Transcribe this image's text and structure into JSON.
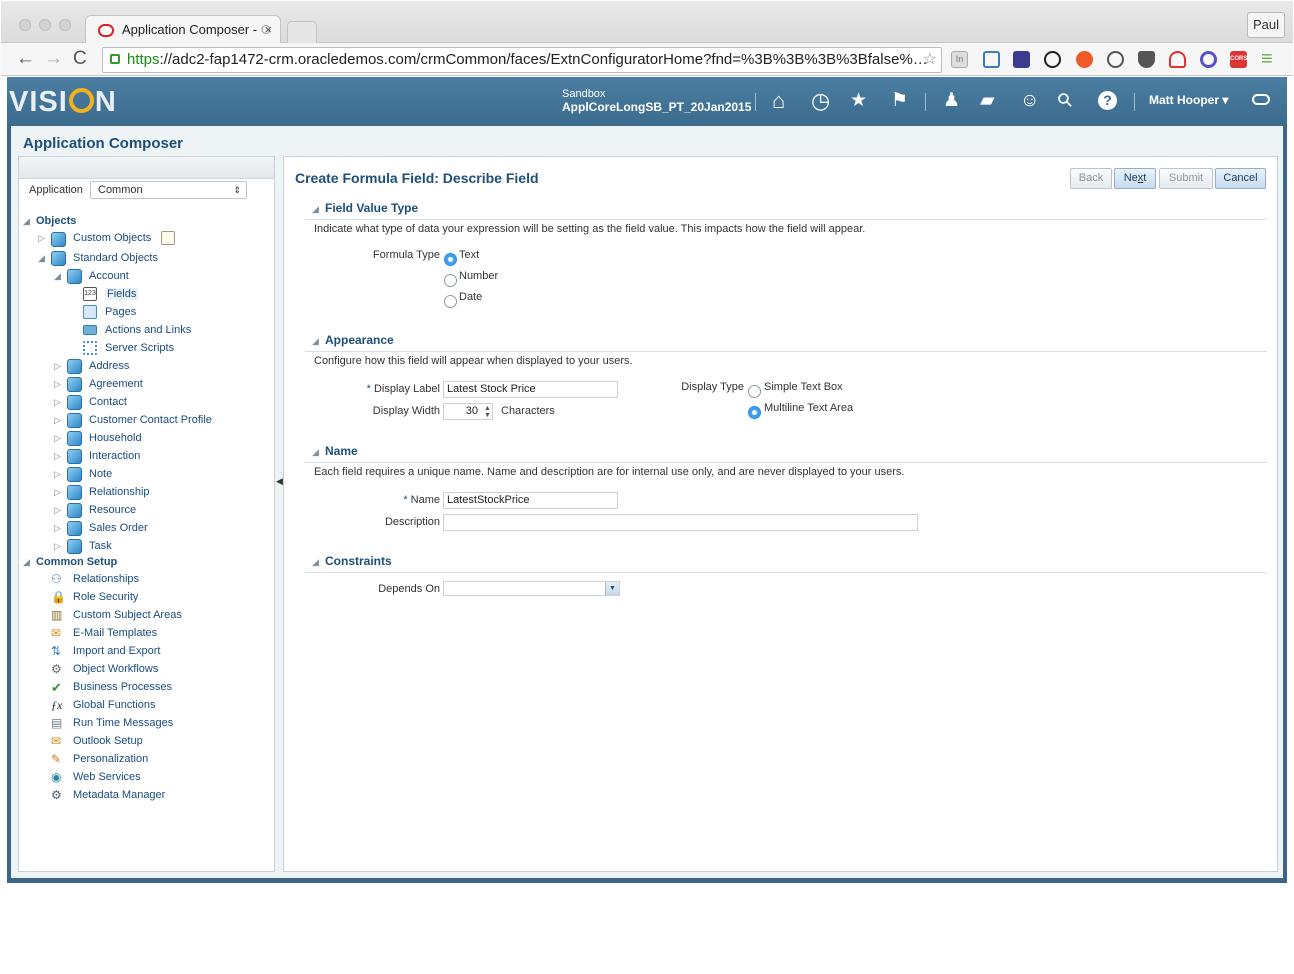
{
  "browser": {
    "tab_title": "Application Composer - ",
    "tab_title_faded": "O",
    "tab_close": "×",
    "user_chip": "Paul",
    "url_scheme": "https",
    "url_rest": "://adc2-fap1472-crm.oracledemos.com/crmCommon/faces/ExtnConfiguratorHome?fnd=%3B%3B%3B%3Bfalse%…",
    "back_glyph": "←",
    "forward_glyph": "→",
    "reload_glyph": "C",
    "bookmark_glyph": "☆",
    "menu_glyph": "≡",
    "ext_label_in": "In",
    "ext_label_cors": "CORS",
    "icons": [
      "lock-icon",
      "star-icon",
      "extension-icon",
      "menu-icon"
    ]
  },
  "header": {
    "logo_left": "VISI",
    "logo_right": "N",
    "sandbox_label": "Sandbox",
    "sandbox_name": "ApplCoreLongSB_PT_20Jan2015",
    "user_name": "Matt Hooper",
    "user_caret": "▾",
    "icons": [
      "home-icon",
      "recent-icon",
      "favorites-icon",
      "flag-icon",
      "notifications-icon",
      "chat-icon",
      "accessibility-icon",
      "search-icon",
      "help-icon"
    ],
    "glyphs": {
      "home": "⌂",
      "recent": "◷",
      "favorites": "★",
      "flag": "⚑",
      "notifications": "♟",
      "chat": "▰",
      "accessibility": "☺",
      "search": "⚲",
      "help": "?"
    }
  },
  "page": {
    "title": "Application Composer"
  },
  "left_panel": {
    "application_label": "Application",
    "application_value": "Common",
    "select_arrow": "⇕",
    "tree_open_glyph": "◢",
    "tree_closed_glyph": "▷",
    "objects_section": "Objects",
    "custom_objects": "Custom Objects",
    "standard_objects": "Standard Objects",
    "account": "Account",
    "account_children": [
      "Fields",
      "Pages",
      "Actions and Links",
      "Server Scripts"
    ],
    "fields_glyph": "123",
    "standard_children": [
      "Address",
      "Agreement",
      "Contact",
      "Customer Contact Profile",
      "Household",
      "Interaction",
      "Note",
      "Relationship",
      "Resource",
      "Sales Order",
      "Task"
    ],
    "common_setup_section": "Common Setup",
    "common_setup_items": [
      "Relationships",
      "Role Security",
      "Custom Subject Areas",
      "E-Mail Templates",
      "Import and Export",
      "Object Workflows",
      "Business Processes",
      "Global Functions",
      "Run Time Messages",
      "Outlook Setup",
      "Personalization",
      "Web Services",
      "Metadata Manager"
    ],
    "common_setup_icons": [
      "relationships-icon",
      "lock-icon",
      "subject-areas-icon",
      "email-icon",
      "import-export-icon",
      "workflow-icon",
      "checkmark-icon",
      "function-icon",
      "messages-icon",
      "outlook-icon",
      "personalization-icon",
      "web-services-icon",
      "metadata-icon"
    ],
    "common_setup_glyphs": [
      "⚇",
      "🔒",
      "▥",
      "✉",
      "⇅",
      "⚙",
      "✔",
      "ƒx",
      "▤",
      "✉",
      "✎",
      "◉",
      "⚙"
    ],
    "splitter_glyph": "◀"
  },
  "form": {
    "title": "Create Formula Field: Describe Field",
    "buttons": {
      "back": "Back",
      "next_prefix": "Ne",
      "next_underlined": "x",
      "next_suffix": "t",
      "submit": "Submit",
      "cancel": "Cancel"
    },
    "field_value_type": {
      "heading": "Field Value Type",
      "description": "Indicate what type of data your expression will be setting as the field value. This impacts how the field will appear.",
      "formula_type_label": "Formula Type",
      "options": [
        "Text",
        "Number",
        "Date"
      ],
      "selected": "Text"
    },
    "appearance": {
      "heading": "Appearance",
      "description": "Configure how this field will appear when displayed to your users.",
      "required_marker": "*",
      "display_label_label": "Display Label",
      "display_label_value": "Latest Stock Price",
      "display_width_label": "Display Width",
      "display_width_value": "30",
      "spinner_up": "▲",
      "spinner_down": "▼",
      "display_width_unit": "Characters",
      "display_type_label": "Display Type",
      "display_type_options": [
        "Simple Text Box",
        "Multiline Text Area"
      ],
      "display_type_selected": "Multiline Text Area"
    },
    "name": {
      "heading": "Name",
      "description": "Each field requires a unique name. Name and description are for internal use only, and are never displayed to your users.",
      "required_marker": "*",
      "name_label": "Name",
      "name_value": "LatestStockPrice",
      "description_label": "Description",
      "description_value": ""
    },
    "constraints": {
      "heading": "Constraints",
      "depends_on_label": "Depends On",
      "depends_on_value": "",
      "dropdown_glyph": "▼"
    },
    "section_toggle_glyph": "◢"
  },
  "colors": {
    "header_bg": "#3b6b8d",
    "accent_text": "#1d4f79",
    "logo_ring": "#f3b21c",
    "radio_selected": "#3ca0ef",
    "https_green": "#1a8a1a"
  }
}
